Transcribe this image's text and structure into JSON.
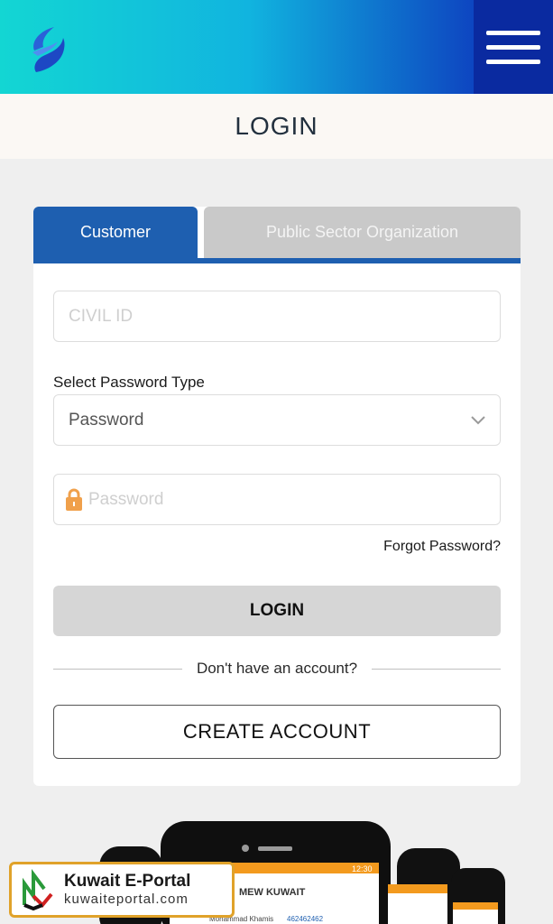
{
  "header": {
    "logo_icon": "brand-logo-icon",
    "menu_icon": "hamburger-menu-icon"
  },
  "page": {
    "title": "LOGIN"
  },
  "tabs": [
    {
      "label": "Customer",
      "active": true
    },
    {
      "label": "Public Sector Organization",
      "active": false
    }
  ],
  "form": {
    "civil_id_placeholder": "CIVIL ID",
    "password_type_label": "Select Password Type",
    "password_type_value": "Password",
    "password_placeholder": "Password",
    "forgot_link": "Forgot Password?",
    "login_button": "LOGIN",
    "no_account_text": "Don't have an account?",
    "create_account_button": "CREATE ACCOUNT"
  },
  "promo": {
    "screen_title": "MEW KUWAIT",
    "row_name": "Mohammad Khamis",
    "row_number": "462462462",
    "status_time": "12:30"
  },
  "watermark": {
    "title": "Kuwait E-Portal",
    "url": "kuwaiteportal.com"
  },
  "colors": {
    "accent": "#1e5fb0",
    "header_start": "#13d6d3",
    "header_end": "#0d3fbf",
    "promo_orange": "#f39a1e"
  }
}
